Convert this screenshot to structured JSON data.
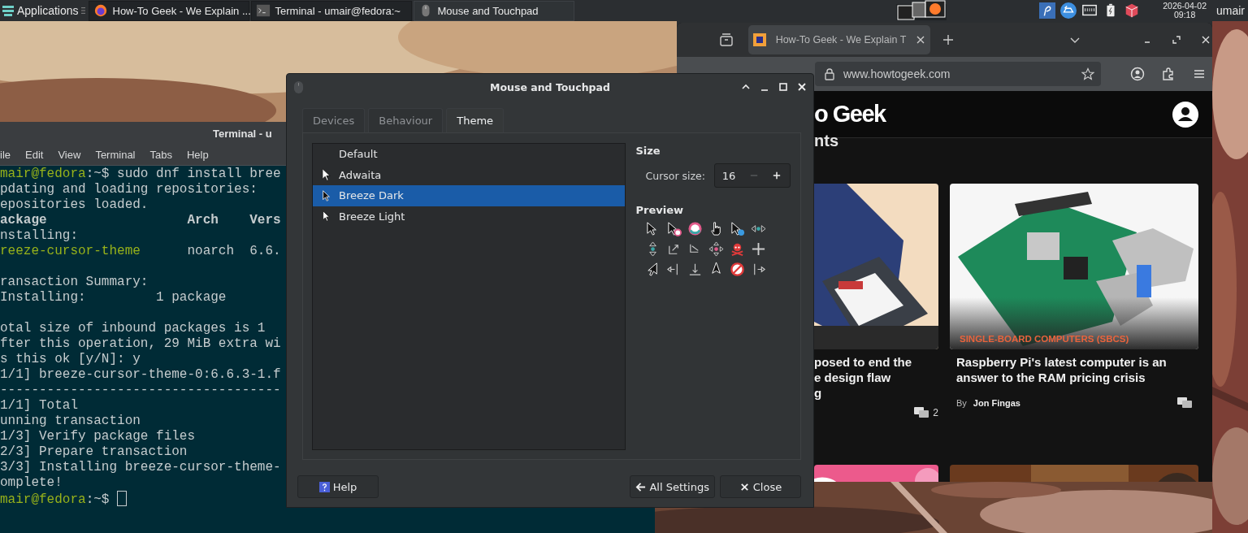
{
  "panel": {
    "menu_label": "Applications",
    "tasks": [
      {
        "label": "How-To Geek - We Explain ...",
        "kind": "browser",
        "selected": false
      },
      {
        "label": "Terminal - umair@fedora:~",
        "kind": "terminal",
        "selected": false
      },
      {
        "label": "Mouse and Touchpad",
        "kind": "mouse",
        "selected": true
      }
    ],
    "date": "2026-04-02",
    "time": "09:18",
    "user": "umair"
  },
  "terminal": {
    "title": "Terminal - u",
    "menu": [
      "ile",
      "Edit",
      "View",
      "Terminal",
      "Tabs",
      "Help"
    ],
    "lines": [
      {
        "parts": [
          {
            "text": "mair@fedora",
            "kind": "user"
          },
          {
            "text": ":~$ sudo dnf install bree",
            "kind": "plain"
          }
        ]
      },
      {
        "parts": [
          {
            "text": "pdating and loading repositories:",
            "kind": "plain"
          }
        ]
      },
      {
        "parts": [
          {
            "text": "epositories loaded.",
            "kind": "plain"
          }
        ]
      },
      {
        "parts": [
          {
            "text": "ackage                  Arch    Vers",
            "kind": "bold"
          }
        ]
      },
      {
        "parts": [
          {
            "text": "nstalling:",
            "kind": "plain"
          }
        ]
      },
      {
        "parts": [
          {
            "text": "reeze-cursor-theme",
            "kind": "user"
          },
          {
            "text": "      noarch  6.6.",
            "kind": "plain"
          }
        ]
      },
      {
        "space_before": true,
        "parts": [
          {
            "text": "ransaction Summary:",
            "kind": "plain"
          }
        ]
      },
      {
        "parts": [
          {
            "text": "Installing:         1 package",
            "kind": "plain"
          }
        ]
      },
      {
        "space_before": true,
        "parts": [
          {
            "text": "otal size of inbound packages is 1",
            "kind": "plain"
          }
        ]
      },
      {
        "parts": [
          {
            "text": "fter this operation, 29 MiB extra wi",
            "kind": "plain"
          }
        ]
      },
      {
        "parts": [
          {
            "text": "s this ok [y/N]: y",
            "kind": "plain"
          }
        ]
      },
      {
        "parts": [
          {
            "text": "1/1] breeze-cursor-theme-0:6.6.3-1.f",
            "kind": "plain"
          }
        ]
      },
      {
        "parts": [
          {
            "text": "------------------------------------",
            "kind": "plain"
          }
        ]
      },
      {
        "parts": [
          {
            "text": "1/1] Total",
            "kind": "plain"
          }
        ]
      },
      {
        "parts": [
          {
            "text": "unning transaction",
            "kind": "plain"
          }
        ]
      },
      {
        "parts": [
          {
            "text": "1/3] Verify package files",
            "kind": "plain"
          }
        ]
      },
      {
        "parts": [
          {
            "text": "2/3] Prepare transaction",
            "kind": "plain"
          }
        ]
      },
      {
        "parts": [
          {
            "text": "3/3] Installing breeze-cursor-theme-",
            "kind": "plain"
          }
        ]
      },
      {
        "parts": [
          {
            "text": "omplete!",
            "kind": "plain"
          }
        ]
      },
      {
        "parts": [
          {
            "text": "mair@fedora",
            "kind": "user"
          },
          {
            "text": ":~$ ",
            "kind": "plain"
          }
        ],
        "cursor": true
      }
    ]
  },
  "browser": {
    "tab_title": "How-To Geek - We Explain T",
    "url_host": "www.howtogeek.com",
    "logo": "o Geek",
    "heading": "nts",
    "cards": [
      {
        "title_lines": [
          "posed to end the",
          "e design flaw",
          "g"
        ],
        "comments": "2"
      },
      {
        "category": "SINGLE-BOARD COMPUTERS (SBCS)",
        "title": "Raspberry Pi's latest computer is an answer to the RAM pricing crisis",
        "by": "By",
        "author": "Jon Fingas"
      }
    ]
  },
  "dialog": {
    "title": "Mouse and Touchpad",
    "tabs": [
      {
        "label": "Devices",
        "selected": false
      },
      {
        "label": "Behaviour",
        "selected": false
      },
      {
        "label": "Theme",
        "selected": true
      }
    ],
    "themes": [
      {
        "label": "Default",
        "kind": "none",
        "selected": false
      },
      {
        "label": "Adwaita",
        "kind": "outline",
        "selected": false
      },
      {
        "label": "Breeze Dark",
        "kind": "dark",
        "selected": true
      },
      {
        "label": "Breeze Light",
        "kind": "light",
        "selected": false
      }
    ],
    "size_heading": "Size",
    "cursor_size_label": "Cursor size:",
    "cursor_size": "16",
    "decrease_disabled": true,
    "preview_heading": "Preview",
    "buttons": [
      {
        "label": "Help",
        "kind": "help"
      },
      {
        "label": "All Settings",
        "kind": "back"
      },
      {
        "label": "Close",
        "kind": "close"
      }
    ]
  }
}
